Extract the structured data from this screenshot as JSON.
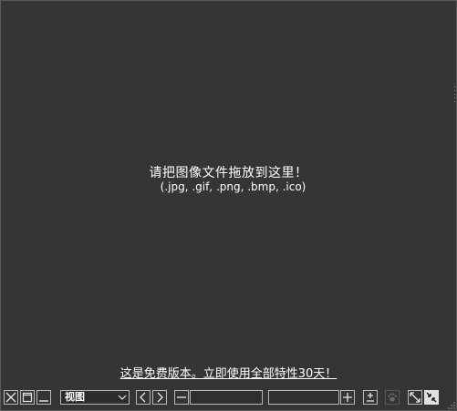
{
  "drop_area": {
    "title": "请把图像文件拖放到这里！",
    "formats": "(.jpg, .gif, .png, .bmp, .ico)"
  },
  "promo": {
    "text": "这是免费版本。立即使用全部特性30天！"
  },
  "toolbar": {
    "view_select": {
      "selected": "视图"
    }
  },
  "icons": {
    "close": "close-icon",
    "window": "window-icon",
    "minimize": "minimize-icon",
    "prev": "chevron-left-icon",
    "next": "chevron-right-icon",
    "zoom_out": "minus-icon",
    "zoom_in": "plus-icon",
    "fit": "plus-minus-icon",
    "paw": "paw-icon",
    "expand": "expand-icon",
    "shrink": "shrink-icon"
  },
  "colors": {
    "background": "#353535",
    "border": "#b8b8b8",
    "text": "#ffffff"
  }
}
